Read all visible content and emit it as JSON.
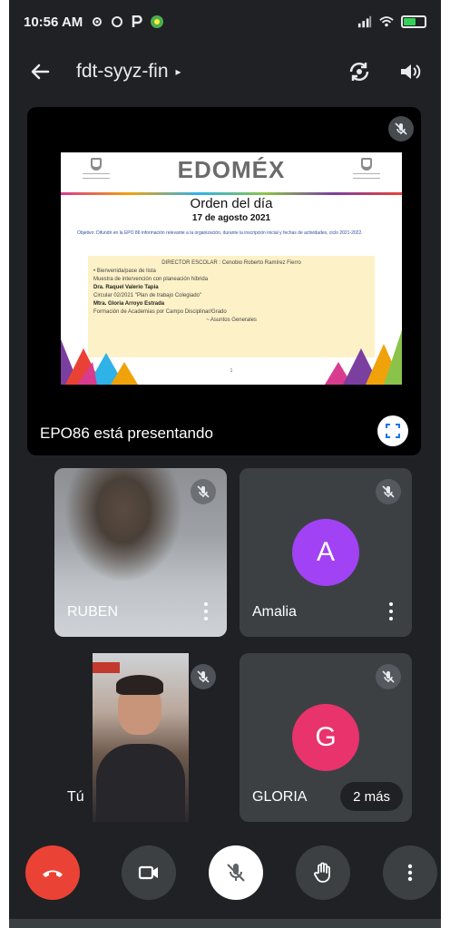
{
  "status_bar": {
    "time": "10:56 AM",
    "app_icons": [
      "settings-icon",
      "sync-icon",
      "p-icon",
      "app-icon"
    ],
    "right_icons": [
      "signal-icon",
      "wifi-icon",
      "battery-icon"
    ]
  },
  "header": {
    "title": "fdt-syyz-fin",
    "caret": "▸"
  },
  "presentation": {
    "presenter_label": "EPO86 está presentando",
    "slide": {
      "logo": "EDOMÉX",
      "title": "Orden del día",
      "date": "17 de agosto 2021",
      "objective": "Objetivo: Difundir en la EPO 86 información relevante a la organización, durante la inscripción inicial y fechas de actividades, ciclo 2021-2022.",
      "agenda": {
        "heading": "DIRECTOR ESCOLAR : Cenobio Roberto Ramírez Fierro",
        "item1": "• Bienvenida/pase de lista",
        "item2": "Muestra de intervención con planeación híbrida",
        "item2_by": "Dra. Raquel Valerio Tapia",
        "item3": "Circular 02/2021 \"Plan de trabajo Colegiado\"",
        "item3_by": "Mtra. Gloria Arroyo Estrada",
        "item4": "Formación de Academias por Campo Disciplinar/Grado",
        "closing": "~ Asuntos Generales"
      },
      "page": "1"
    }
  },
  "participants": [
    {
      "name": "RUBEN",
      "type": "video",
      "muted": true,
      "has_menu": true
    },
    {
      "name": "Amalia",
      "initial": "A",
      "type": "avatar",
      "color": "#a142f4",
      "muted": true,
      "has_menu": true
    },
    {
      "name": "Tú",
      "type": "video",
      "muted": true,
      "has_menu": false
    },
    {
      "name": "GLORIA",
      "initial": "G",
      "type": "avatar",
      "color": "#e8336d",
      "muted": true,
      "more_label": "2 más"
    }
  ],
  "controls": [
    "end-call-icon",
    "camera-icon",
    "mic-off-icon",
    "raise-hand-icon",
    "more-vert-icon"
  ],
  "colors": {
    "end_call": "#ea4335",
    "button": "#3c4043",
    "mic_bg": "#ffffff",
    "background": "#202124"
  }
}
